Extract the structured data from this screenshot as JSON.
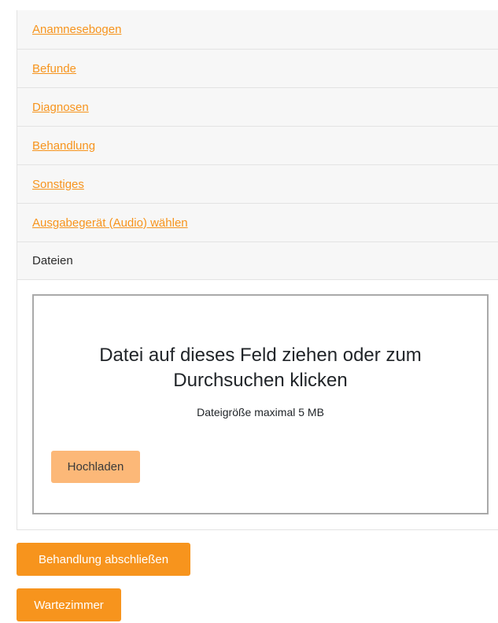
{
  "accordion": {
    "items": [
      {
        "label": "Anamnesebogen"
      },
      {
        "label": "Befunde"
      },
      {
        "label": "Diagnosen"
      },
      {
        "label": "Behandlung"
      },
      {
        "label": "Sonstiges"
      },
      {
        "label": "Ausgabegerät (Audio) wählen"
      },
      {
        "label": "Dateien"
      }
    ]
  },
  "dropzone": {
    "title": "Datei auf dieses Feld ziehen oder zum Durchsuchen klicken",
    "max_size_text": "Dateigröße maximal 5 MB",
    "upload_label": "Hochladen"
  },
  "actions": {
    "finish_label": "Behandlung abschließen",
    "waiting_room_label": "Wartezimmer"
  },
  "colors": {
    "accent": "#f7941d",
    "upload_button": "#fcb878",
    "panel_header": "#f7f7f7"
  }
}
